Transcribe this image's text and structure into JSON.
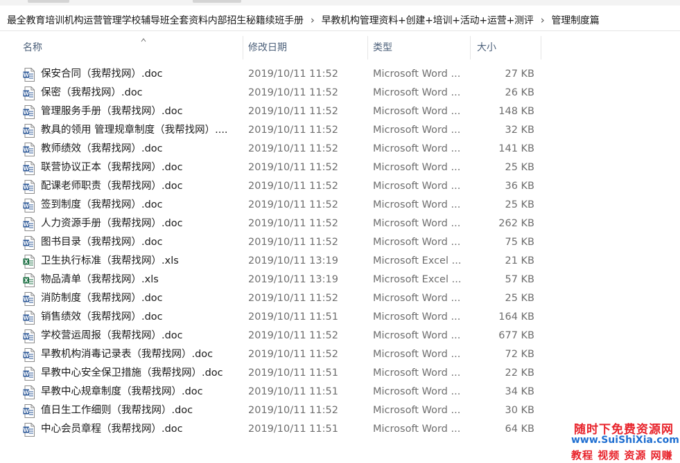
{
  "breadcrumb": [
    "最全教育培训机构运营管理学校辅导班全套资料内部招生秘籍续班手册",
    "早教机构管理资料+创建+培训+活动+运营+测评",
    "管理制度篇"
  ],
  "columns": {
    "name": "名称",
    "date": "修改日期",
    "type": "类型",
    "size": "大小"
  },
  "colors": {
    "word_icon": "#2b5797",
    "excel_icon": "#1e7145",
    "header_text": "#4c607a"
  },
  "files": [
    {
      "name": "保安合同（我帮找网）.doc",
      "date": "2019/10/11 11:52",
      "type": "Microsoft Word ...",
      "size": "27 KB",
      "icon": "word-doc-icon"
    },
    {
      "name": "保密（我帮找网）.doc",
      "date": "2019/10/11 11:52",
      "type": "Microsoft Word ...",
      "size": "26 KB",
      "icon": "word-doc-icon"
    },
    {
      "name": "管理服务手册（我帮找网）.doc",
      "date": "2019/10/11 11:52",
      "type": "Microsoft Word ...",
      "size": "148 KB",
      "icon": "word-doc-icon"
    },
    {
      "name": "教具的领用 管理规章制度（我帮找网）....",
      "date": "2019/10/11 11:52",
      "type": "Microsoft Word ...",
      "size": "32 KB",
      "icon": "word-doc-icon"
    },
    {
      "name": "教师绩效（我帮找网）.doc",
      "date": "2019/10/11 11:52",
      "type": "Microsoft Word ...",
      "size": "141 KB",
      "icon": "word-doc-icon"
    },
    {
      "name": "联营协议正本（我帮找网）.doc",
      "date": "2019/10/11 11:52",
      "type": "Microsoft Word ...",
      "size": "25 KB",
      "icon": "word-doc-icon"
    },
    {
      "name": "配课老师职责（我帮找网）.doc",
      "date": "2019/10/11 11:52",
      "type": "Microsoft Word ...",
      "size": "36 KB",
      "icon": "word-doc-icon"
    },
    {
      "name": "签到制度（我帮找网）.doc",
      "date": "2019/10/11 11:52",
      "type": "Microsoft Word ...",
      "size": "25 KB",
      "icon": "word-doc-icon"
    },
    {
      "name": "人力资源手册（我帮找网）.doc",
      "date": "2019/10/11 11:52",
      "type": "Microsoft Word ...",
      "size": "262 KB",
      "icon": "word-doc-icon"
    },
    {
      "name": "图书目录（我帮找网）.doc",
      "date": "2019/10/11 11:52",
      "type": "Microsoft Word ...",
      "size": "75 KB",
      "icon": "word-doc-icon"
    },
    {
      "name": "卫生执行标准（我帮找网）.xls",
      "date": "2019/10/11 13:19",
      "type": "Microsoft Excel ...",
      "size": "21 KB",
      "icon": "excel-xls-icon"
    },
    {
      "name": "物品清单（我帮找网）.xls",
      "date": "2019/10/11 13:19",
      "type": "Microsoft Excel ...",
      "size": "57 KB",
      "icon": "excel-xls-icon"
    },
    {
      "name": "消防制度（我帮找网）.doc",
      "date": "2019/10/11 11:52",
      "type": "Microsoft Word ...",
      "size": "25 KB",
      "icon": "word-doc-icon"
    },
    {
      "name": "销售绩效（我帮找网）.doc",
      "date": "2019/10/11 11:51",
      "type": "Microsoft Word ...",
      "size": "164 KB",
      "icon": "word-doc-icon"
    },
    {
      "name": "学校营运周报（我帮找网）.doc",
      "date": "2019/10/11 11:52",
      "type": "Microsoft Word ...",
      "size": "677 KB",
      "icon": "word-doc-icon"
    },
    {
      "name": "早教机构消毒记录表（我帮找网）.doc",
      "date": "2019/10/11 11:52",
      "type": "Microsoft Word ...",
      "size": "72 KB",
      "icon": "word-doc-icon"
    },
    {
      "name": "早教中心安全保卫措施（我帮找网）.doc",
      "date": "2019/10/11 11:51",
      "type": "Microsoft Word ...",
      "size": "22 KB",
      "icon": "word-doc-icon"
    },
    {
      "name": "早教中心规章制度（我帮找网）.doc",
      "date": "2019/10/11 11:51",
      "type": "Microsoft Word ...",
      "size": "34 KB",
      "icon": "word-doc-icon"
    },
    {
      "name": "值日生工作细则（我帮找网）.doc",
      "date": "2019/10/11 11:52",
      "type": "Microsoft Word ...",
      "size": "30 KB",
      "icon": "word-doc-icon"
    },
    {
      "name": "中心会员章程（我帮找网）.doc",
      "date": "2019/10/11 11:51",
      "type": "Microsoft Word ...",
      "size": "64 KB",
      "icon": "word-doc-icon"
    }
  ],
  "watermark": {
    "line1": "随时下免费资源网",
    "line2": "www.SuiShiXia.com",
    "line3": "教程 视频 资源 网赚"
  }
}
